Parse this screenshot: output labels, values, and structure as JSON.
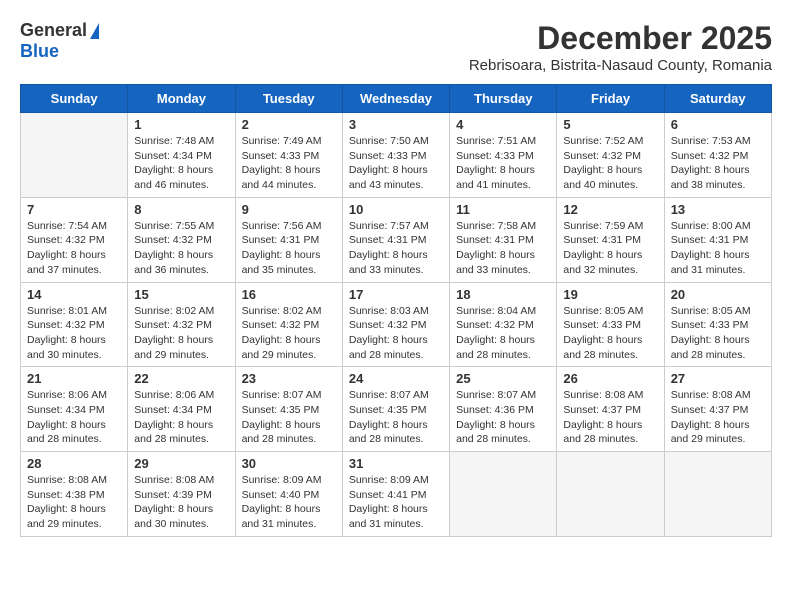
{
  "logo": {
    "general": "General",
    "blue": "Blue"
  },
  "title": "December 2025",
  "subtitle": "Rebrisoara, Bistrita-Nasaud County, Romania",
  "days_of_week": [
    "Sunday",
    "Monday",
    "Tuesday",
    "Wednesday",
    "Thursday",
    "Friday",
    "Saturday"
  ],
  "weeks": [
    [
      {
        "day": "",
        "info": ""
      },
      {
        "day": "1",
        "info": "Sunrise: 7:48 AM\nSunset: 4:34 PM\nDaylight: 8 hours\nand 46 minutes."
      },
      {
        "day": "2",
        "info": "Sunrise: 7:49 AM\nSunset: 4:33 PM\nDaylight: 8 hours\nand 44 minutes."
      },
      {
        "day": "3",
        "info": "Sunrise: 7:50 AM\nSunset: 4:33 PM\nDaylight: 8 hours\nand 43 minutes."
      },
      {
        "day": "4",
        "info": "Sunrise: 7:51 AM\nSunset: 4:33 PM\nDaylight: 8 hours\nand 41 minutes."
      },
      {
        "day": "5",
        "info": "Sunrise: 7:52 AM\nSunset: 4:32 PM\nDaylight: 8 hours\nand 40 minutes."
      },
      {
        "day": "6",
        "info": "Sunrise: 7:53 AM\nSunset: 4:32 PM\nDaylight: 8 hours\nand 38 minutes."
      }
    ],
    [
      {
        "day": "7",
        "info": "Sunrise: 7:54 AM\nSunset: 4:32 PM\nDaylight: 8 hours\nand 37 minutes."
      },
      {
        "day": "8",
        "info": "Sunrise: 7:55 AM\nSunset: 4:32 PM\nDaylight: 8 hours\nand 36 minutes."
      },
      {
        "day": "9",
        "info": "Sunrise: 7:56 AM\nSunset: 4:31 PM\nDaylight: 8 hours\nand 35 minutes."
      },
      {
        "day": "10",
        "info": "Sunrise: 7:57 AM\nSunset: 4:31 PM\nDaylight: 8 hours\nand 33 minutes."
      },
      {
        "day": "11",
        "info": "Sunrise: 7:58 AM\nSunset: 4:31 PM\nDaylight: 8 hours\nand 33 minutes."
      },
      {
        "day": "12",
        "info": "Sunrise: 7:59 AM\nSunset: 4:31 PM\nDaylight: 8 hours\nand 32 minutes."
      },
      {
        "day": "13",
        "info": "Sunrise: 8:00 AM\nSunset: 4:31 PM\nDaylight: 8 hours\nand 31 minutes."
      }
    ],
    [
      {
        "day": "14",
        "info": "Sunrise: 8:01 AM\nSunset: 4:32 PM\nDaylight: 8 hours\nand 30 minutes."
      },
      {
        "day": "15",
        "info": "Sunrise: 8:02 AM\nSunset: 4:32 PM\nDaylight: 8 hours\nand 29 minutes."
      },
      {
        "day": "16",
        "info": "Sunrise: 8:02 AM\nSunset: 4:32 PM\nDaylight: 8 hours\nand 29 minutes."
      },
      {
        "day": "17",
        "info": "Sunrise: 8:03 AM\nSunset: 4:32 PM\nDaylight: 8 hours\nand 28 minutes."
      },
      {
        "day": "18",
        "info": "Sunrise: 8:04 AM\nSunset: 4:32 PM\nDaylight: 8 hours\nand 28 minutes."
      },
      {
        "day": "19",
        "info": "Sunrise: 8:05 AM\nSunset: 4:33 PM\nDaylight: 8 hours\nand 28 minutes."
      },
      {
        "day": "20",
        "info": "Sunrise: 8:05 AM\nSunset: 4:33 PM\nDaylight: 8 hours\nand 28 minutes."
      }
    ],
    [
      {
        "day": "21",
        "info": "Sunrise: 8:06 AM\nSunset: 4:34 PM\nDaylight: 8 hours\nand 28 minutes."
      },
      {
        "day": "22",
        "info": "Sunrise: 8:06 AM\nSunset: 4:34 PM\nDaylight: 8 hours\nand 28 minutes."
      },
      {
        "day": "23",
        "info": "Sunrise: 8:07 AM\nSunset: 4:35 PM\nDaylight: 8 hours\nand 28 minutes."
      },
      {
        "day": "24",
        "info": "Sunrise: 8:07 AM\nSunset: 4:35 PM\nDaylight: 8 hours\nand 28 minutes."
      },
      {
        "day": "25",
        "info": "Sunrise: 8:07 AM\nSunset: 4:36 PM\nDaylight: 8 hours\nand 28 minutes."
      },
      {
        "day": "26",
        "info": "Sunrise: 8:08 AM\nSunset: 4:37 PM\nDaylight: 8 hours\nand 28 minutes."
      },
      {
        "day": "27",
        "info": "Sunrise: 8:08 AM\nSunset: 4:37 PM\nDaylight: 8 hours\nand 29 minutes."
      }
    ],
    [
      {
        "day": "28",
        "info": "Sunrise: 8:08 AM\nSunset: 4:38 PM\nDaylight: 8 hours\nand 29 minutes."
      },
      {
        "day": "29",
        "info": "Sunrise: 8:08 AM\nSunset: 4:39 PM\nDaylight: 8 hours\nand 30 minutes."
      },
      {
        "day": "30",
        "info": "Sunrise: 8:09 AM\nSunset: 4:40 PM\nDaylight: 8 hours\nand 31 minutes."
      },
      {
        "day": "31",
        "info": "Sunrise: 8:09 AM\nSunset: 4:41 PM\nDaylight: 8 hours\nand 31 minutes."
      },
      {
        "day": "",
        "info": ""
      },
      {
        "day": "",
        "info": ""
      },
      {
        "day": "",
        "info": ""
      }
    ]
  ]
}
